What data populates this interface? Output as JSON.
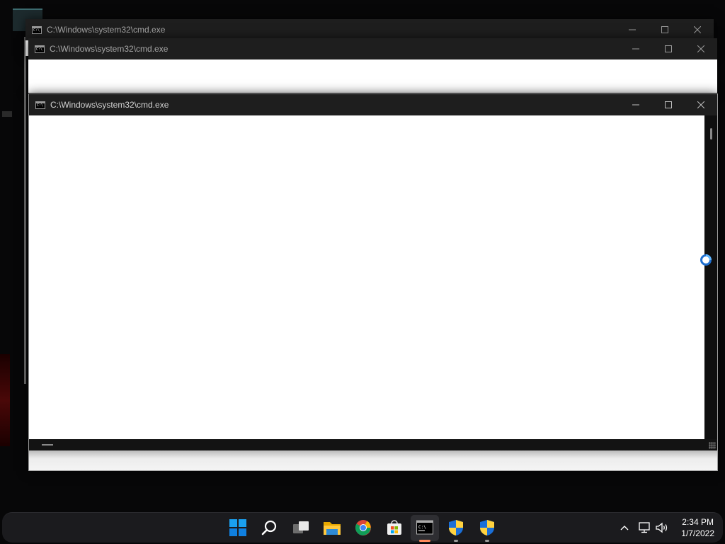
{
  "windows": [
    {
      "id": "back",
      "title": "C:\\Windows\\system32\\cmd.exe",
      "state": "inactive"
    },
    {
      "id": "middle",
      "title": "C:\\Windows\\system32\\cmd.exe",
      "state": "inactive"
    },
    {
      "id": "front",
      "title": "C:\\Windows\\system32\\cmd.exe",
      "state": "active"
    }
  ],
  "window_controls": {
    "minimize": "minimize",
    "maximize": "maximize",
    "close": "close"
  },
  "colors": {
    "titlebar": "#1e1e1e",
    "console_bg": "#ffffff",
    "taskbar": "#1b1b1e",
    "accent": "#0078d4",
    "running_indicator_active": "#ff8a5b"
  },
  "taskbar": {
    "pinned": [
      {
        "name": "start-button",
        "icon": "windows-logo-icon"
      },
      {
        "name": "search-button",
        "icon": "search-icon"
      },
      {
        "name": "task-view-button",
        "icon": "task-view-icon"
      },
      {
        "name": "file-explorer-button",
        "icon": "folder-icon"
      },
      {
        "name": "chrome-button",
        "icon": "chrome-icon"
      },
      {
        "name": "microsoft-store-button",
        "icon": "store-icon"
      },
      {
        "name": "command-prompt-button",
        "icon": "terminal-icon",
        "active": true
      },
      {
        "name": "uac-prompt-button-1",
        "icon": "shield-icon"
      },
      {
        "name": "uac-prompt-button-2",
        "icon": "shield-icon"
      }
    ],
    "tray": [
      {
        "name": "show-hidden-icons",
        "icon": "chevron-up-icon"
      },
      {
        "name": "network-status",
        "icon": "network-icon"
      },
      {
        "name": "volume",
        "icon": "speaker-icon"
      }
    ],
    "clock": {
      "time": "2:34 PM",
      "date": "1/7/2022"
    }
  }
}
